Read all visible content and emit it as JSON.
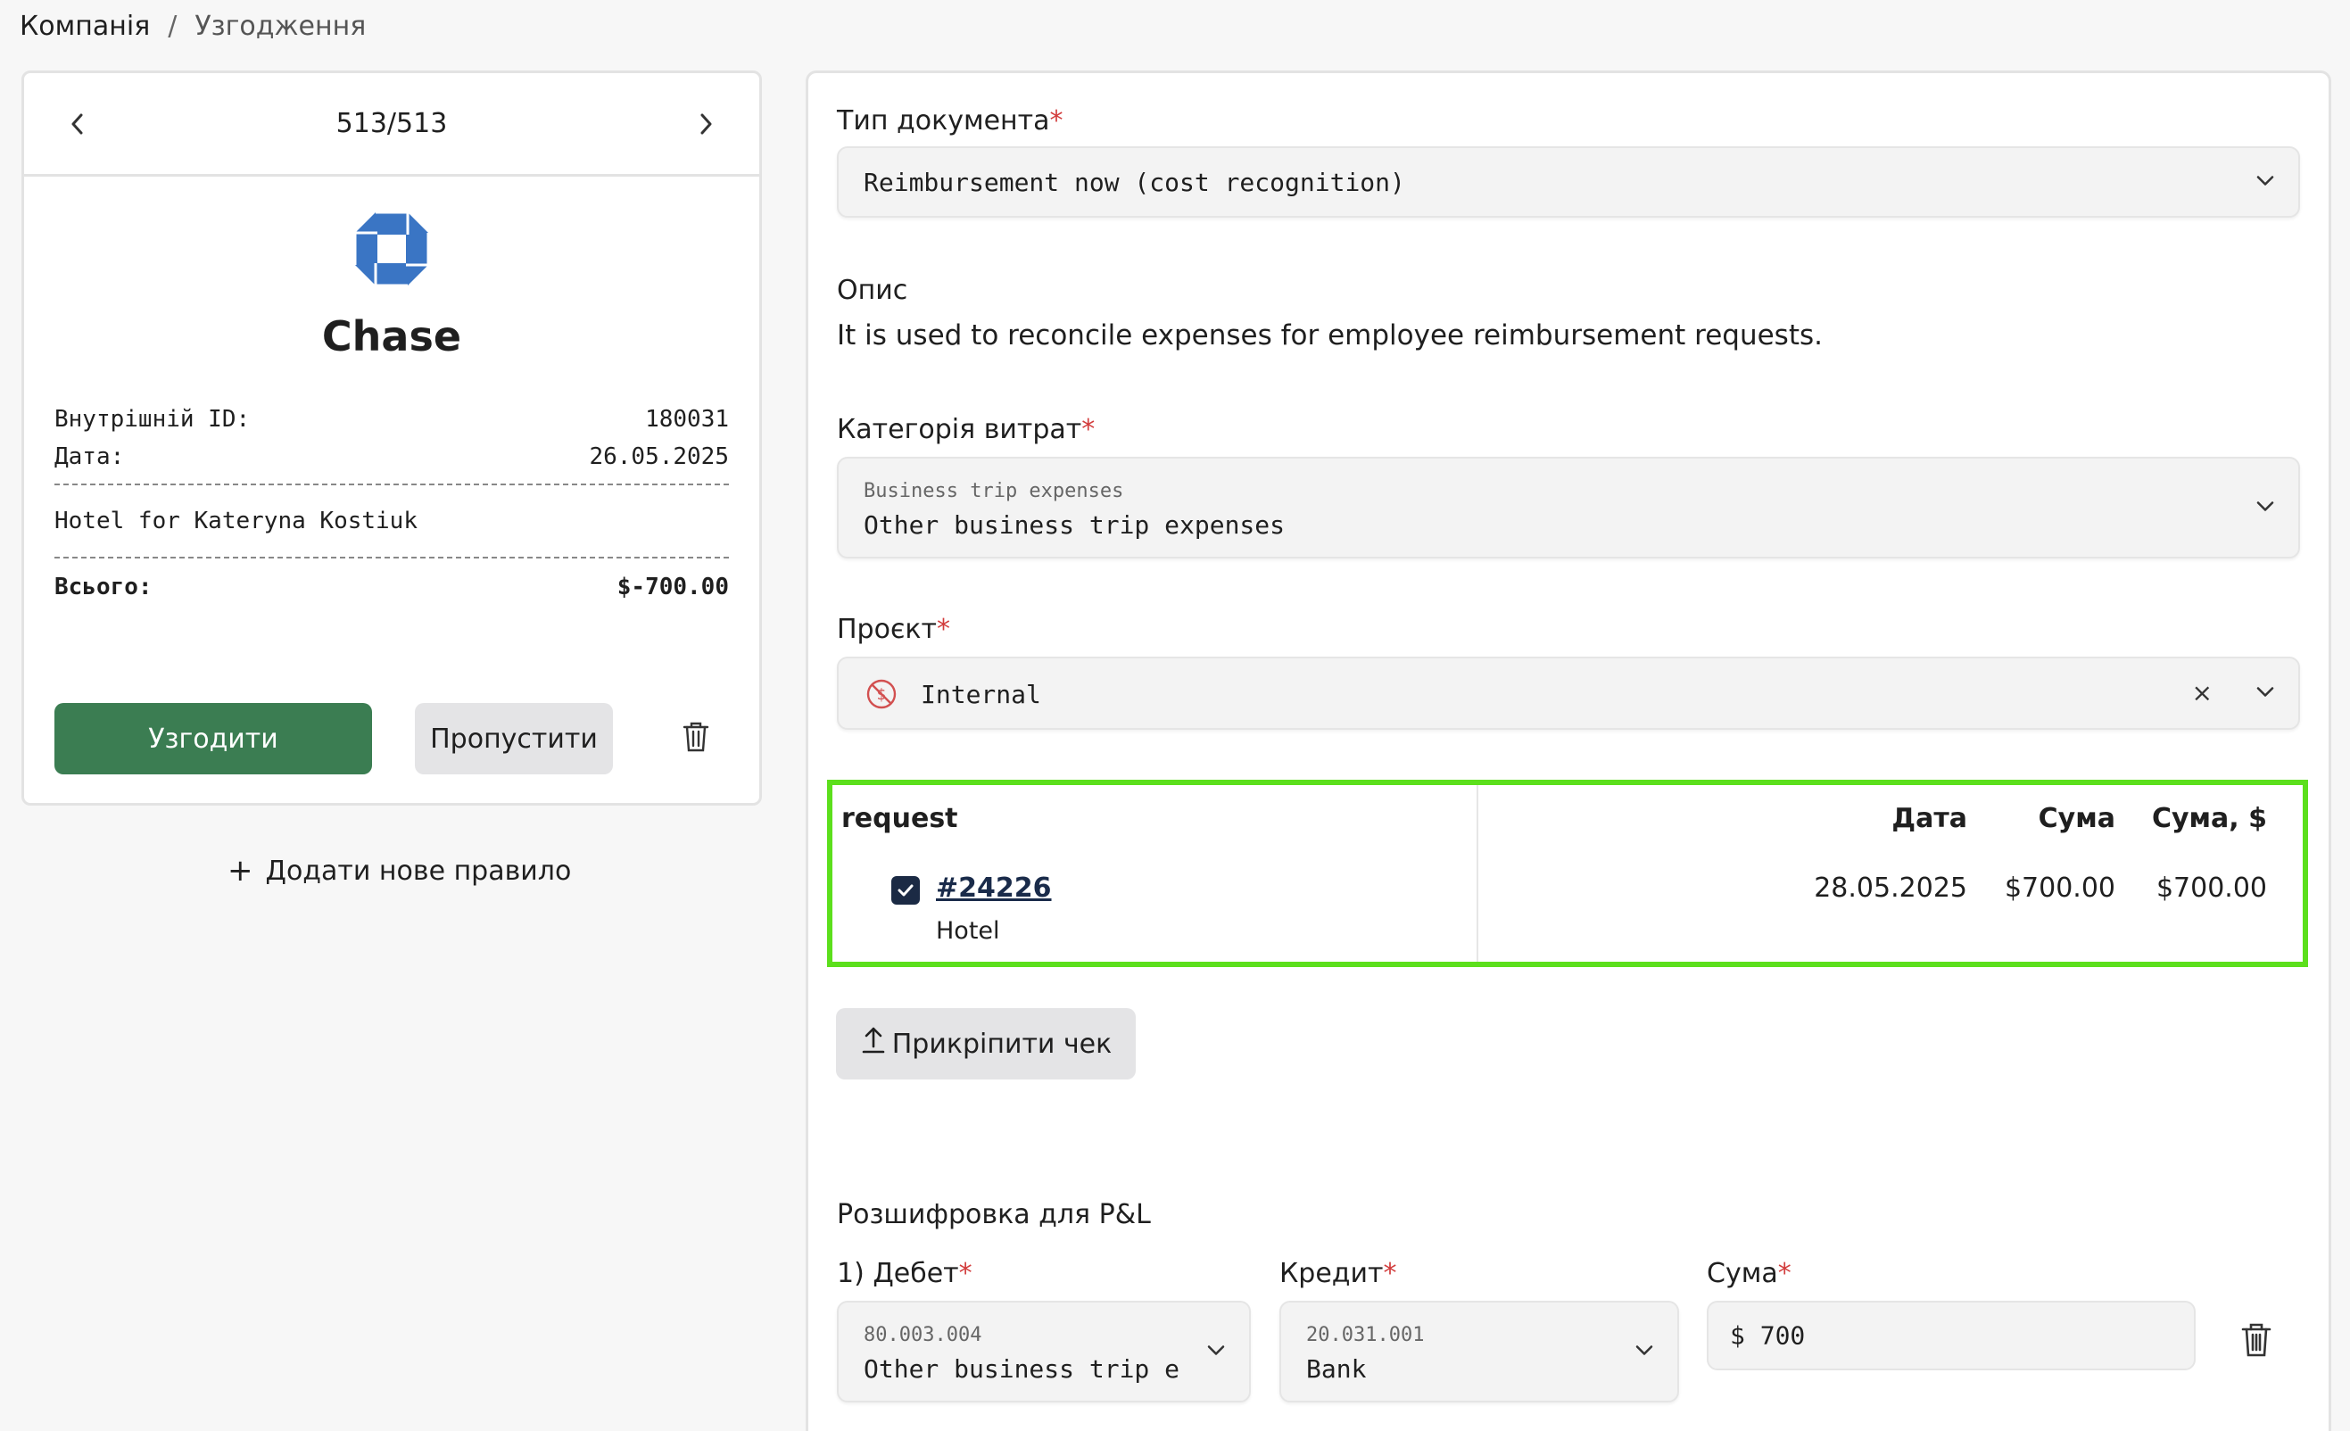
{
  "breadcrumb": {
    "root": "Компанія",
    "separator": "/",
    "current": "Узгодження"
  },
  "pager": {
    "counter": "513/513"
  },
  "bank": {
    "name": "Chase",
    "logo_icon": "chase-octagon-logo",
    "logo_color": "#3a75c4"
  },
  "receipt": {
    "id_label": "Внутрішній ID:",
    "id_value": "180031",
    "date_label": "Дата:",
    "date_value": "26.05.2025",
    "description": "Hotel for Kateryna Kostiuk",
    "total_label": "Всього:",
    "total_value": "$-700.00"
  },
  "actions": {
    "approve": "Узгодити",
    "skip": "Пропустити"
  },
  "add_rule": {
    "icon": "+",
    "label": "Додати нове правило"
  },
  "form": {
    "doc_type": {
      "label": "Тип документа",
      "required_mark": "*",
      "value": "Reimbursement now (cost recognition)"
    },
    "description": {
      "label": "Опис",
      "text": "It is used to reconcile expenses for employee reimbursement requests."
    },
    "category": {
      "label": "Категорія витрат",
      "required_mark": "*",
      "group": "Business trip expenses",
      "value": "Other business trip expenses"
    },
    "project": {
      "label": "Проєкт",
      "required_mark": "*",
      "value": "Internal",
      "clear": "×"
    }
  },
  "request_table": {
    "headers": {
      "request": "request",
      "date": "Дата",
      "amount": "Сума",
      "amount_usd": "Сума, $"
    },
    "rows": [
      {
        "id": "#24226",
        "subtitle": "Hotel",
        "date": "28.05.2025",
        "amount": "$700.00",
        "amount_usd": "$700.00",
        "checked": true
      }
    ],
    "highlight_color": "#5cdf1c"
  },
  "attach": {
    "label": "Прикріпити чек"
  },
  "pl": {
    "title": "Розшифровка для P&L",
    "debit": {
      "label": "1) Дебет",
      "required_mark": "*",
      "code": "80.003.004",
      "value": "Other business trip e"
    },
    "credit": {
      "label": "Кредит",
      "required_mark": "*",
      "code": "20.031.001",
      "value": "Bank"
    },
    "amount": {
      "label": "Сума",
      "required_mark": "*",
      "value": "$ 700"
    }
  },
  "colors": {
    "approve": "#3b7d52",
    "required": "#d23c3c"
  }
}
